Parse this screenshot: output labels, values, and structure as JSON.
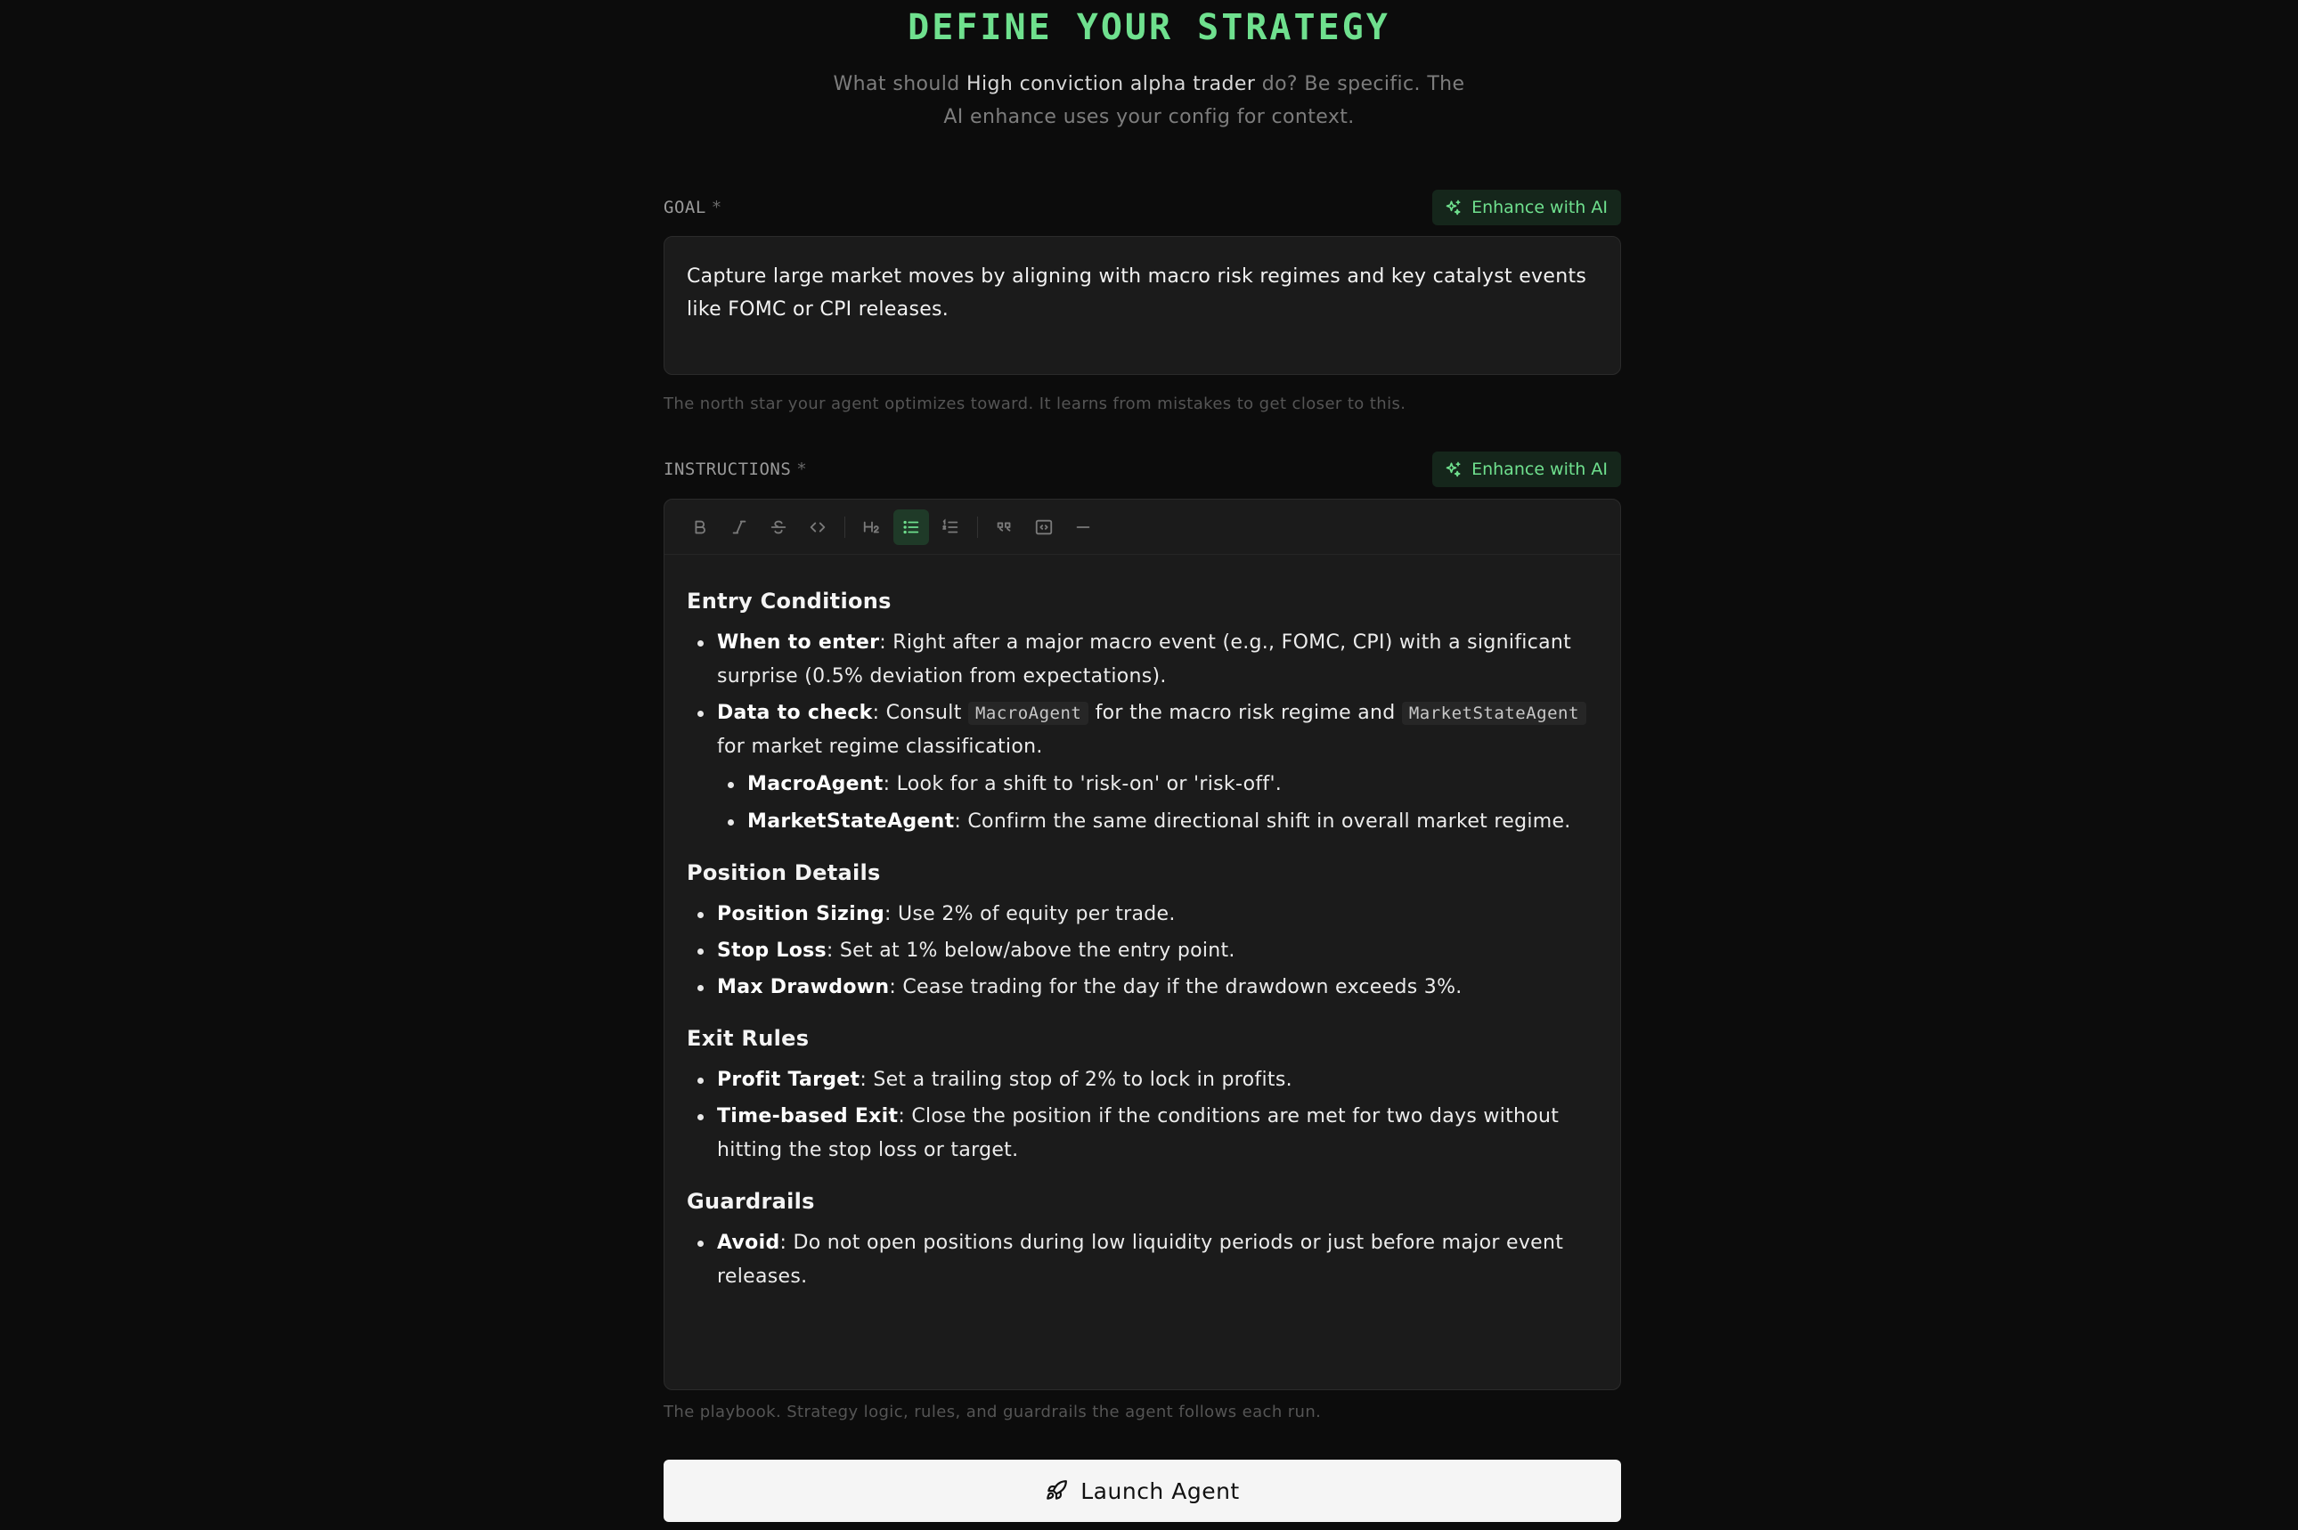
{
  "header": {
    "title": "DEFINE YOUR STRATEGY",
    "subtitle_pre": "What should ",
    "agent_name": "High conviction alpha trader",
    "subtitle_post": " do? Be specific. The",
    "subtitle_line2": "AI enhance uses your config for context."
  },
  "goal": {
    "label": "GOAL",
    "required_mark": "*",
    "enhance_label": "Enhance with AI",
    "value": "Capture large market moves by aligning with macro risk regimes and key catalyst events like FOMC or CPI releases.",
    "help": "The north star your agent optimizes toward. It learns from mistakes to get closer to this."
  },
  "instructions": {
    "label": "INSTRUCTIONS",
    "required_mark": "*",
    "enhance_label": "Enhance with AI",
    "help": "The playbook. Strategy logic, rules, and guardrails the agent follows each run.",
    "toolbar": [
      "bold-icon",
      "italic-icon",
      "strikethrough-icon",
      "code-icon",
      "heading-icon",
      "bullet-list-icon",
      "ordered-list-icon",
      "quote-icon",
      "code-block-icon",
      "horizontal-rule-icon"
    ],
    "active_tool": "bullet-list-icon",
    "content": {
      "entry": {
        "heading": "Entry Conditions",
        "i1_bold": "When to enter",
        "i1_text": ": Right after a major macro event (e.g., FOMC, CPI) with a significant surprise (0.5% deviation from expectations).",
        "i2_bold": "Data to check",
        "i2_pre": ": Consult ",
        "i2_code1": "MacroAgent",
        "i2_mid": " for the macro risk regime and ",
        "i2_code2": "MarketStateAgent",
        "i2_post": " for market regime classification.",
        "n1_bold": "MacroAgent",
        "n1_text": ": Look for a shift to 'risk-on' or 'risk-off'.",
        "n2_bold": "MarketStateAgent",
        "n2_text": ": Confirm the same directional shift in overall market regime."
      },
      "position": {
        "heading": "Position Details",
        "i1_bold": "Position Sizing",
        "i1_text": ": Use 2% of equity per trade.",
        "i2_bold": "Stop Loss",
        "i2_text": ": Set at 1% below/above the entry point.",
        "i3_bold": "Max Drawdown",
        "i3_text": ": Cease trading for the day if the drawdown exceeds 3%."
      },
      "exit": {
        "heading": "Exit Rules",
        "i1_bold": "Profit Target",
        "i1_text": ": Set a trailing stop of 2% to lock in profits.",
        "i2_bold": "Time-based Exit",
        "i2_text": ": Close the position if the conditions are met for two days without hitting the stop loss or target."
      },
      "guardrails": {
        "heading": "Guardrails",
        "i1_bold": "Avoid",
        "i1_text": ": Do not open positions during low liquidity periods or just before major event releases."
      }
    }
  },
  "launch": {
    "label": "Launch Agent"
  },
  "colors": {
    "accent": "#6fe08e",
    "background": "#0c0c0c",
    "panel": "#1b1b1b"
  }
}
